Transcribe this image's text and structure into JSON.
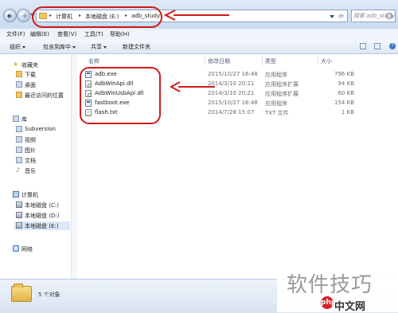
{
  "address_bar": {
    "breadcrumbs": [
      "计算机",
      "本地磁盘 (E:)",
      "adb_study"
    ],
    "search_placeholder": "搜索 adb_study"
  },
  "menu": [
    "文件(F)",
    "编辑(E)",
    "查看(V)",
    "工具(T)",
    "帮助(H)"
  ],
  "toolbar": {
    "organize": "组织",
    "include_in_library": "包含到库中",
    "share": "共享",
    "new_folder": "新建文件夹"
  },
  "nav_pane": {
    "favorites": {
      "label": "收藏夹",
      "items": [
        "下载",
        "桌面",
        "最近访问的位置"
      ]
    },
    "libraries": {
      "label": "库",
      "items": [
        "Subversion",
        "视频",
        "图片",
        "文档",
        "音乐"
      ]
    },
    "computer": {
      "label": "计算机",
      "items": [
        "本地磁盘 (C:)",
        "本地磁盘 (D:)",
        "本地磁盘 (E:)"
      ],
      "selected": "本地磁盘 (E:)"
    },
    "network": {
      "label": "网络"
    }
  },
  "file_list": {
    "columns": [
      "名称",
      "修改日期",
      "类型",
      "大小"
    ],
    "files": [
      {
        "name": "adb.exe",
        "date": "2015/10/27 16:48",
        "type": "应用程序",
        "size": "796 KB",
        "icon": "exe-icon"
      },
      {
        "name": "AdbWinApi.dll",
        "date": "2014/3/10 20:21",
        "type": "应用程序扩展",
        "size": "94 KB",
        "icon": "dll-icon"
      },
      {
        "name": "AdbWinUsbApi.dll",
        "date": "2014/3/10 20:21",
        "type": "应用程序扩展",
        "size": "60 KB",
        "icon": "dll-icon"
      },
      {
        "name": "fastboot.exe",
        "date": "2015/10/27 16:48",
        "type": "应用程序",
        "size": "154 KB",
        "icon": "exe-icon"
      },
      {
        "name": "flash.txt",
        "date": "2014/7/28 15:07",
        "type": "TXT 文件",
        "size": "1 KB",
        "icon": "txt-icon"
      }
    ]
  },
  "status": {
    "item_count": "5 个对象"
  },
  "watermark": {
    "text": "软件技巧",
    "site": "中文网",
    "logo": "php"
  },
  "colors": {
    "annotation": "#d11a1a",
    "selection": "#dbe8f7"
  }
}
